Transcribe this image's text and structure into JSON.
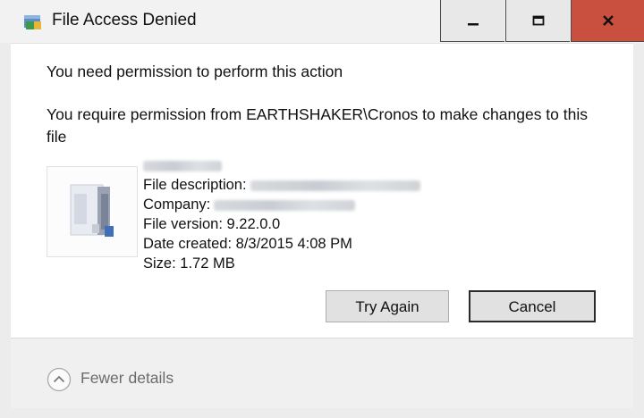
{
  "window": {
    "title": "File Access Denied",
    "close_color": "#c9503f",
    "buttons": {
      "minimize": "minimize-icon",
      "maximize": "maximize-icon",
      "close": "close-icon"
    }
  },
  "dialog": {
    "heading": "You need permission to perform this action",
    "message": "You require permission from EARTHSHAKER\\Cronos to make changes to this file"
  },
  "file": {
    "icon": "file-icon",
    "description_label": "File description:",
    "company_label": "Company:",
    "version_label": "File version:",
    "version_value": "9.22.0.0",
    "date_label": "Date created:",
    "date_value": "8/3/2015 4:08 PM",
    "size_label": "Size:",
    "size_value": "1.72 MB"
  },
  "actions": {
    "try_again": "Try Again",
    "cancel": "Cancel"
  },
  "footer": {
    "fewer_details": "Fewer details",
    "icon": "chevron-up-circle-icon"
  }
}
